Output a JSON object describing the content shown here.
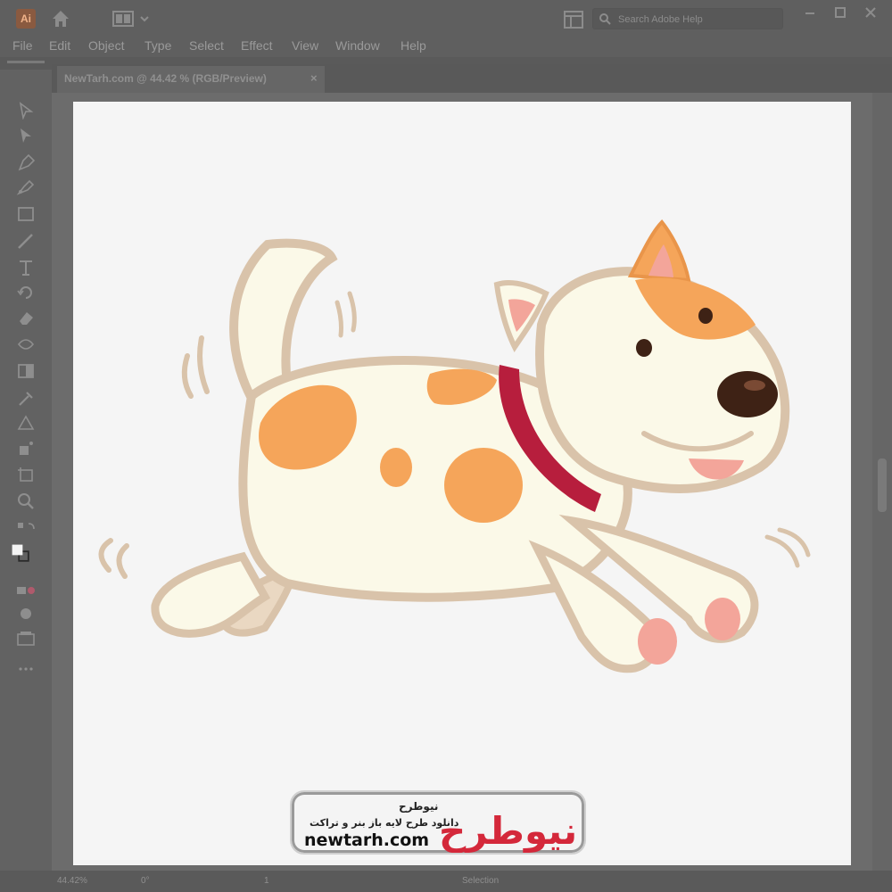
{
  "app": {
    "logo_text": "Ai",
    "search_placeholder": "Search Adobe Help"
  },
  "menu": [
    "File",
    "Edit",
    "Object",
    "Type",
    "Select",
    "Effect",
    "View",
    "Window",
    "Help"
  ],
  "document": {
    "tab_title": "NewTarh.com @ 44.42 % (RGB/Preview)",
    "close_label": "×"
  },
  "status": {
    "zoom": "44.42%",
    "rotation": "0°",
    "artboard_number": "1",
    "mode": "Selection"
  },
  "watermark": {
    "brand_fa": "نیوطرح",
    "tagline_fa": "دانلود طرح لایه باز بنر و تراکت",
    "url": "newtarh.com",
    "logo_fa": "نیوطرح"
  },
  "colors": {
    "body": "#fbf9e8",
    "spot": "#f5a55a",
    "outline": "#d9c3aa",
    "collar": "#b71e3d",
    "nose": "#3e2215",
    "tongue": "#f3a59a",
    "brand_red": "#d4283a",
    "brand_blue": "#1f61b3"
  }
}
